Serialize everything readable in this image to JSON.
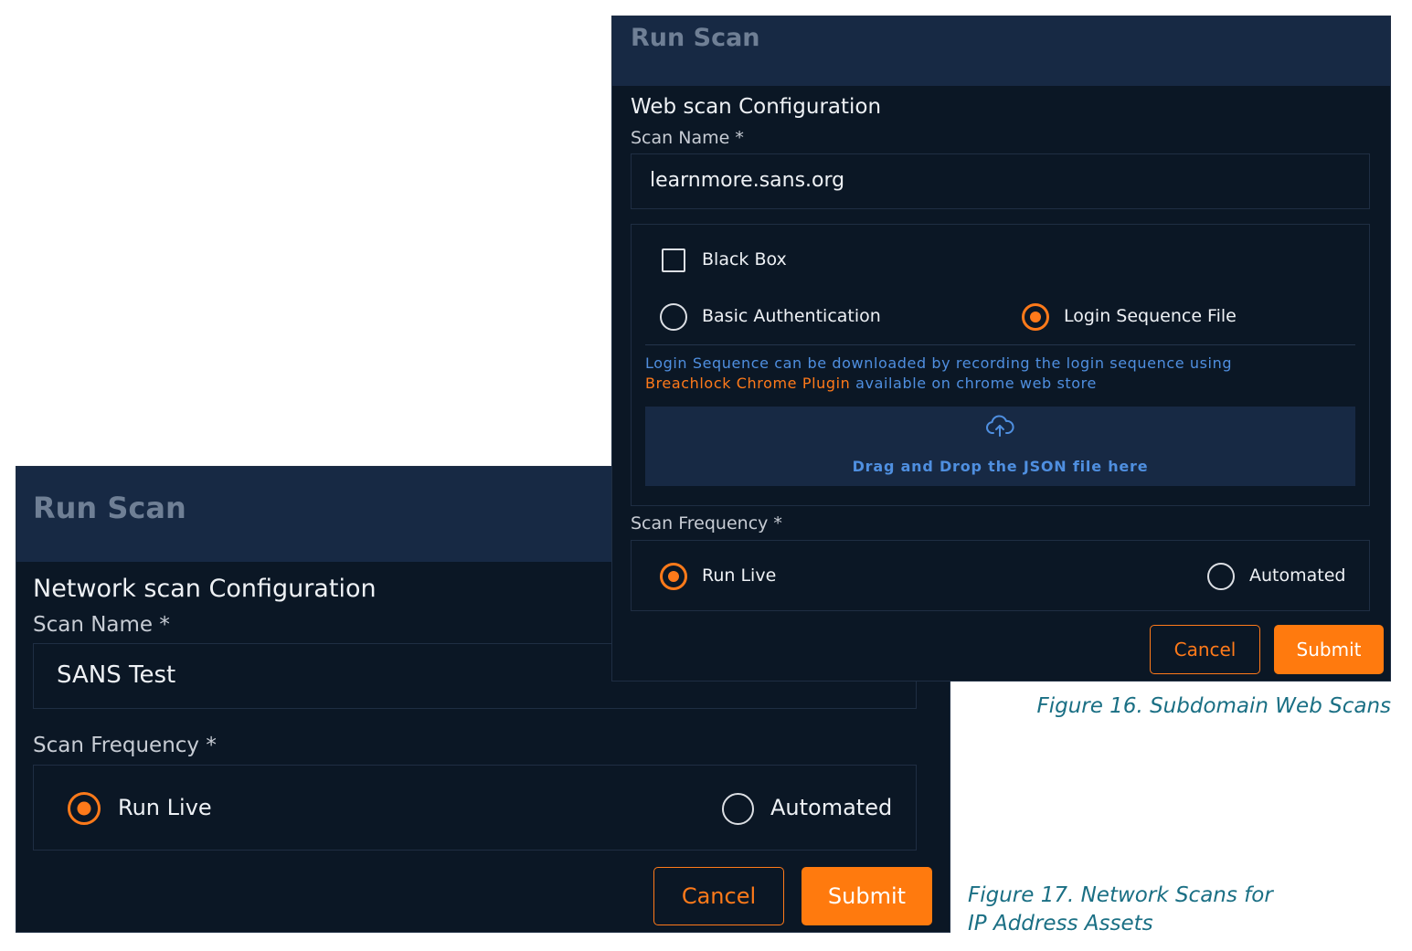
{
  "network_dialog": {
    "title": "Run Scan",
    "section_title": "Network scan Configuration",
    "scan_name_label": "Scan Name *",
    "scan_name_value": "SANS Test",
    "frequency_label": "Scan Frequency *",
    "options": {
      "run_live": "Run Live",
      "automated": "Automated"
    },
    "selected_option": "Run Live",
    "cancel": "Cancel",
    "submit": "Submit"
  },
  "web_dialog": {
    "title": "Run Scan",
    "section_title": "Web scan Configuration",
    "scan_name_label": "Scan Name *",
    "scan_name_value": "learnmore.sans.org",
    "black_box_label": "Black Box",
    "black_box_checked": false,
    "auth_options": {
      "basic": "Basic Authentication",
      "login_sequence": "Login Sequence File"
    },
    "selected_auth": "Login Sequence File",
    "info_text_1": "Login Sequence can be downloaded by recording the login sequence using",
    "plugin_link": "Breachlock Chrome Plugin",
    "info_text_2": "available on chrome web store",
    "dropzone_text": "Drag and Drop the JSON file here",
    "frequency_label": "Scan Frequency *",
    "options": {
      "run_live": "Run Live",
      "automated": "Automated"
    },
    "selected_option": "Run Live",
    "cancel": "Cancel",
    "submit": "Submit"
  },
  "captions": {
    "fig16": "Figure 16. Subdomain Web Scans",
    "fig17_line1": "Figure 17. Network Scans for",
    "fig17_line2": "IP Address Assets"
  },
  "colors": {
    "accent": "#ff7a1a",
    "panel_bg": "#0b1725",
    "header_bg": "#172944",
    "info_blue": "#4f8fe0",
    "caption": "#1a6f84"
  },
  "icons": {
    "upload": "cloud-upload-icon"
  }
}
